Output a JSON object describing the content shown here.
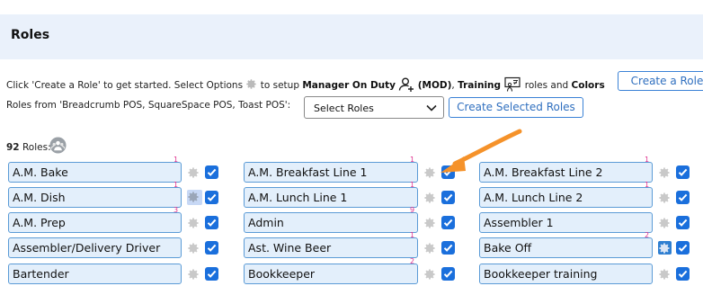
{
  "header": {
    "title": "Roles"
  },
  "intro": {
    "text1": "Click 'Create a Role' to get started. Select Options",
    "text2": "to setup",
    "mod_label": "Manager On Duty",
    "mod_abbr": "(MOD)",
    "text3": ", ",
    "training_label": "Training",
    "text4": "roles and",
    "colors_label": "Colors",
    "create_button": "Create a Role"
  },
  "import": {
    "label": "Roles from 'Breadcrumb POS, SquareSpace POS, Toast POS':",
    "select_value": "Select Roles",
    "create_selected_button": "Create Selected Roles"
  },
  "roles_count": {
    "count": "92",
    "label": "Roles:"
  },
  "roles": [
    {
      "name": "A.M. Bake",
      "badge": "1",
      "checked": true
    },
    {
      "name": "A.M. Breakfast Line 1",
      "badge": "1",
      "checked": true
    },
    {
      "name": "A.M. Breakfast Line 2",
      "badge": "1",
      "checked": true
    },
    {
      "name": "A.M. Dish",
      "badge": "1",
      "checked": true
    },
    {
      "name": "A.M. Lunch Line 1",
      "badge": "1",
      "checked": true
    },
    {
      "name": "A.M. Lunch Line 2",
      "badge": "1",
      "checked": true
    },
    {
      "name": "A.M. Prep",
      "badge": "3",
      "checked": true
    },
    {
      "name": "Admin",
      "badge": "9",
      "checked": true
    },
    {
      "name": "Assembler 1",
      "badge": "",
      "checked": true
    },
    {
      "name": "Assembler/Delivery Driver",
      "badge": "",
      "checked": true
    },
    {
      "name": "Ast. Wine Beer",
      "badge": "1",
      "checked": true
    },
    {
      "name": "Bake Off",
      "badge": "2",
      "checked": true
    },
    {
      "name": "Bartender",
      "badge": "",
      "checked": true
    },
    {
      "name": "Bookkeeper",
      "badge": "2",
      "checked": true
    },
    {
      "name": "Bookkeeper training",
      "badge": "",
      "checked": true
    }
  ],
  "colors": {
    "accent": "#1a6fdc",
    "header_bg": "#eaf1fb",
    "role_bg": "#e3effb",
    "badge": "#e0338f",
    "arrow": "#f5922a"
  }
}
